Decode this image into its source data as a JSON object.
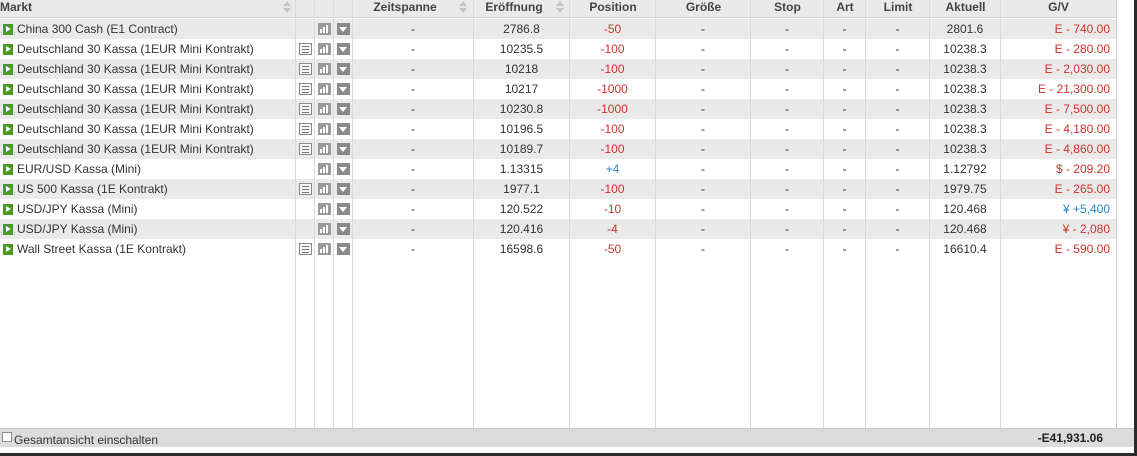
{
  "header": {
    "markt": "Markt",
    "zeitspanne": "Zeitspanne",
    "eroeffnung": "Eröffnung",
    "position": "Position",
    "groesse": "Größe",
    "stop": "Stop",
    "art": "Art",
    "limit": "Limit",
    "aktuell": "Aktuell",
    "gv": "G/V"
  },
  "rows": [
    {
      "name": "China 300 Cash (E1 Contract)",
      "news": false,
      "zeitspanne": "-",
      "eroeffnung": "2786.8",
      "position": "-50",
      "pos_sign": "neg",
      "groesse": "-",
      "stop": "-",
      "art": "-",
      "limit": "-",
      "aktuell": "2801.6",
      "gv": "E - 740.00",
      "gv_sign": "neg"
    },
    {
      "name": "Deutschland 30 Kassa (1EUR Mini Kontrakt)",
      "news": true,
      "zeitspanne": "-",
      "eroeffnung": "10235.5",
      "position": "-100",
      "pos_sign": "neg",
      "groesse": "-",
      "stop": "-",
      "art": "-",
      "limit": "-",
      "aktuell": "10238.3",
      "gv": "E - 280.00",
      "gv_sign": "neg"
    },
    {
      "name": "Deutschland 30 Kassa (1EUR Mini Kontrakt)",
      "news": true,
      "zeitspanne": "-",
      "eroeffnung": "10218",
      "position": "-100",
      "pos_sign": "neg",
      "groesse": "-",
      "stop": "-",
      "art": "-",
      "limit": "-",
      "aktuell": "10238.3",
      "gv": "E - 2,030.00",
      "gv_sign": "neg"
    },
    {
      "name": "Deutschland 30 Kassa (1EUR Mini Kontrakt)",
      "news": true,
      "zeitspanne": "-",
      "eroeffnung": "10217",
      "position": "-1000",
      "pos_sign": "neg",
      "groesse": "-",
      "stop": "-",
      "art": "-",
      "limit": "-",
      "aktuell": "10238.3",
      "gv": "E - 21,300.00",
      "gv_sign": "neg"
    },
    {
      "name": "Deutschland 30 Kassa (1EUR Mini Kontrakt)",
      "news": true,
      "zeitspanne": "-",
      "eroeffnung": "10230.8",
      "position": "-1000",
      "pos_sign": "neg",
      "groesse": "-",
      "stop": "-",
      "art": "-",
      "limit": "-",
      "aktuell": "10238.3",
      "gv": "E - 7,500.00",
      "gv_sign": "neg"
    },
    {
      "name": "Deutschland 30 Kassa (1EUR Mini Kontrakt)",
      "news": true,
      "zeitspanne": "-",
      "eroeffnung": "10196.5",
      "position": "-100",
      "pos_sign": "neg",
      "groesse": "-",
      "stop": "-",
      "art": "-",
      "limit": "-",
      "aktuell": "10238.3",
      "gv": "E - 4,180.00",
      "gv_sign": "neg"
    },
    {
      "name": "Deutschland 30 Kassa (1EUR Mini Kontrakt)",
      "news": true,
      "zeitspanne": "-",
      "eroeffnung": "10189.7",
      "position": "-100",
      "pos_sign": "neg",
      "groesse": "-",
      "stop": "-",
      "art": "-",
      "limit": "-",
      "aktuell": "10238.3",
      "gv": "E - 4,860.00",
      "gv_sign": "neg"
    },
    {
      "name": "EUR/USD Kassa (Mini)",
      "news": false,
      "zeitspanne": "-",
      "eroeffnung": "1.13315",
      "position": "+4",
      "pos_sign": "pos",
      "groesse": "-",
      "stop": "-",
      "art": "-",
      "limit": "-",
      "aktuell": "1.12792",
      "gv": "$ - 209.20",
      "gv_sign": "neg"
    },
    {
      "name": "US 500 Kassa (1E Kontrakt)",
      "news": true,
      "zeitspanne": "-",
      "eroeffnung": "1977.1",
      "position": "-100",
      "pos_sign": "neg",
      "groesse": "-",
      "stop": "-",
      "art": "-",
      "limit": "-",
      "aktuell": "1979.75",
      "gv": "E - 265.00",
      "gv_sign": "neg"
    },
    {
      "name": "USD/JPY Kassa (Mini)",
      "news": false,
      "zeitspanne": "-",
      "eroeffnung": "120.522",
      "position": "-10",
      "pos_sign": "neg",
      "groesse": "-",
      "stop": "-",
      "art": "-",
      "limit": "-",
      "aktuell": "120.468",
      "gv": "¥ +5,400",
      "gv_sign": "pos"
    },
    {
      "name": "USD/JPY Kassa (Mini)",
      "news": false,
      "zeitspanne": "-",
      "eroeffnung": "120.416",
      "position": "-4",
      "pos_sign": "neg",
      "groesse": "-",
      "stop": "-",
      "art": "-",
      "limit": "-",
      "aktuell": "120.468",
      "gv": "¥ - 2,080",
      "gv_sign": "neg"
    },
    {
      "name": "Wall Street Kassa (1E Kontrakt)",
      "news": true,
      "zeitspanne": "-",
      "eroeffnung": "16598.6",
      "position": "-50",
      "pos_sign": "neg",
      "groesse": "-",
      "stop": "-",
      "art": "-",
      "limit": "-",
      "aktuell": "16610.4",
      "gv": "E - 590.00",
      "gv_sign": "neg"
    }
  ],
  "footer": {
    "toggle_label": "Gesamtansicht einschalten",
    "total": "-E41,931.06"
  },
  "colors": {
    "negative": "#d0312d",
    "positive": "#2a87c8",
    "play": "#4a9a2a"
  },
  "icons": {
    "row_expand": "play-icon",
    "news": "news-icon",
    "chart": "chart-icon",
    "menu": "dropdown-icon"
  }
}
